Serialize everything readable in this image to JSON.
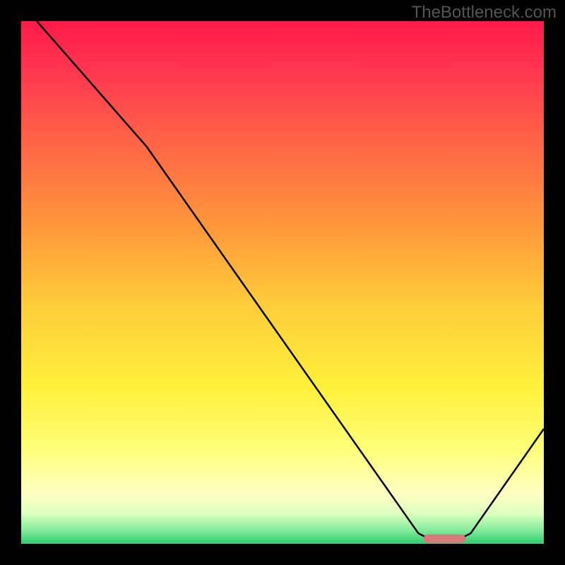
{
  "watermark": "TheBottleneck.com",
  "chart_data": {
    "type": "line",
    "title": "",
    "xlabel": "",
    "ylabel": "",
    "xlim": [
      0,
      100
    ],
    "ylim": [
      0,
      100
    ],
    "curve": {
      "name": "bottleneck-curve",
      "points": [
        {
          "x": 3,
          "y": 100
        },
        {
          "x": 24,
          "y": 76
        },
        {
          "x": 76,
          "y": 2
        },
        {
          "x": 78,
          "y": 1
        },
        {
          "x": 84,
          "y": 1
        },
        {
          "x": 86,
          "y": 2
        },
        {
          "x": 100,
          "y": 22
        }
      ]
    },
    "marker": {
      "name": "bottleneck-marker",
      "x_start": 77,
      "x_end": 85,
      "y": 1,
      "color": "#d87a7a"
    },
    "gradient_stops": [
      {
        "pos": 0.0,
        "color": "#ff1a4a"
      },
      {
        "pos": 0.1,
        "color": "#ff3850"
      },
      {
        "pos": 0.25,
        "color": "#ff6a45"
      },
      {
        "pos": 0.4,
        "color": "#ff9a3a"
      },
      {
        "pos": 0.55,
        "color": "#ffcf3a"
      },
      {
        "pos": 0.7,
        "color": "#fff03a"
      },
      {
        "pos": 0.82,
        "color": "#ffff7a"
      },
      {
        "pos": 0.9,
        "color": "#ffffc0"
      },
      {
        "pos": 0.94,
        "color": "#e0ffc0"
      },
      {
        "pos": 0.97,
        "color": "#90f0a0"
      },
      {
        "pos": 1.0,
        "color": "#2ecc71"
      }
    ]
  }
}
